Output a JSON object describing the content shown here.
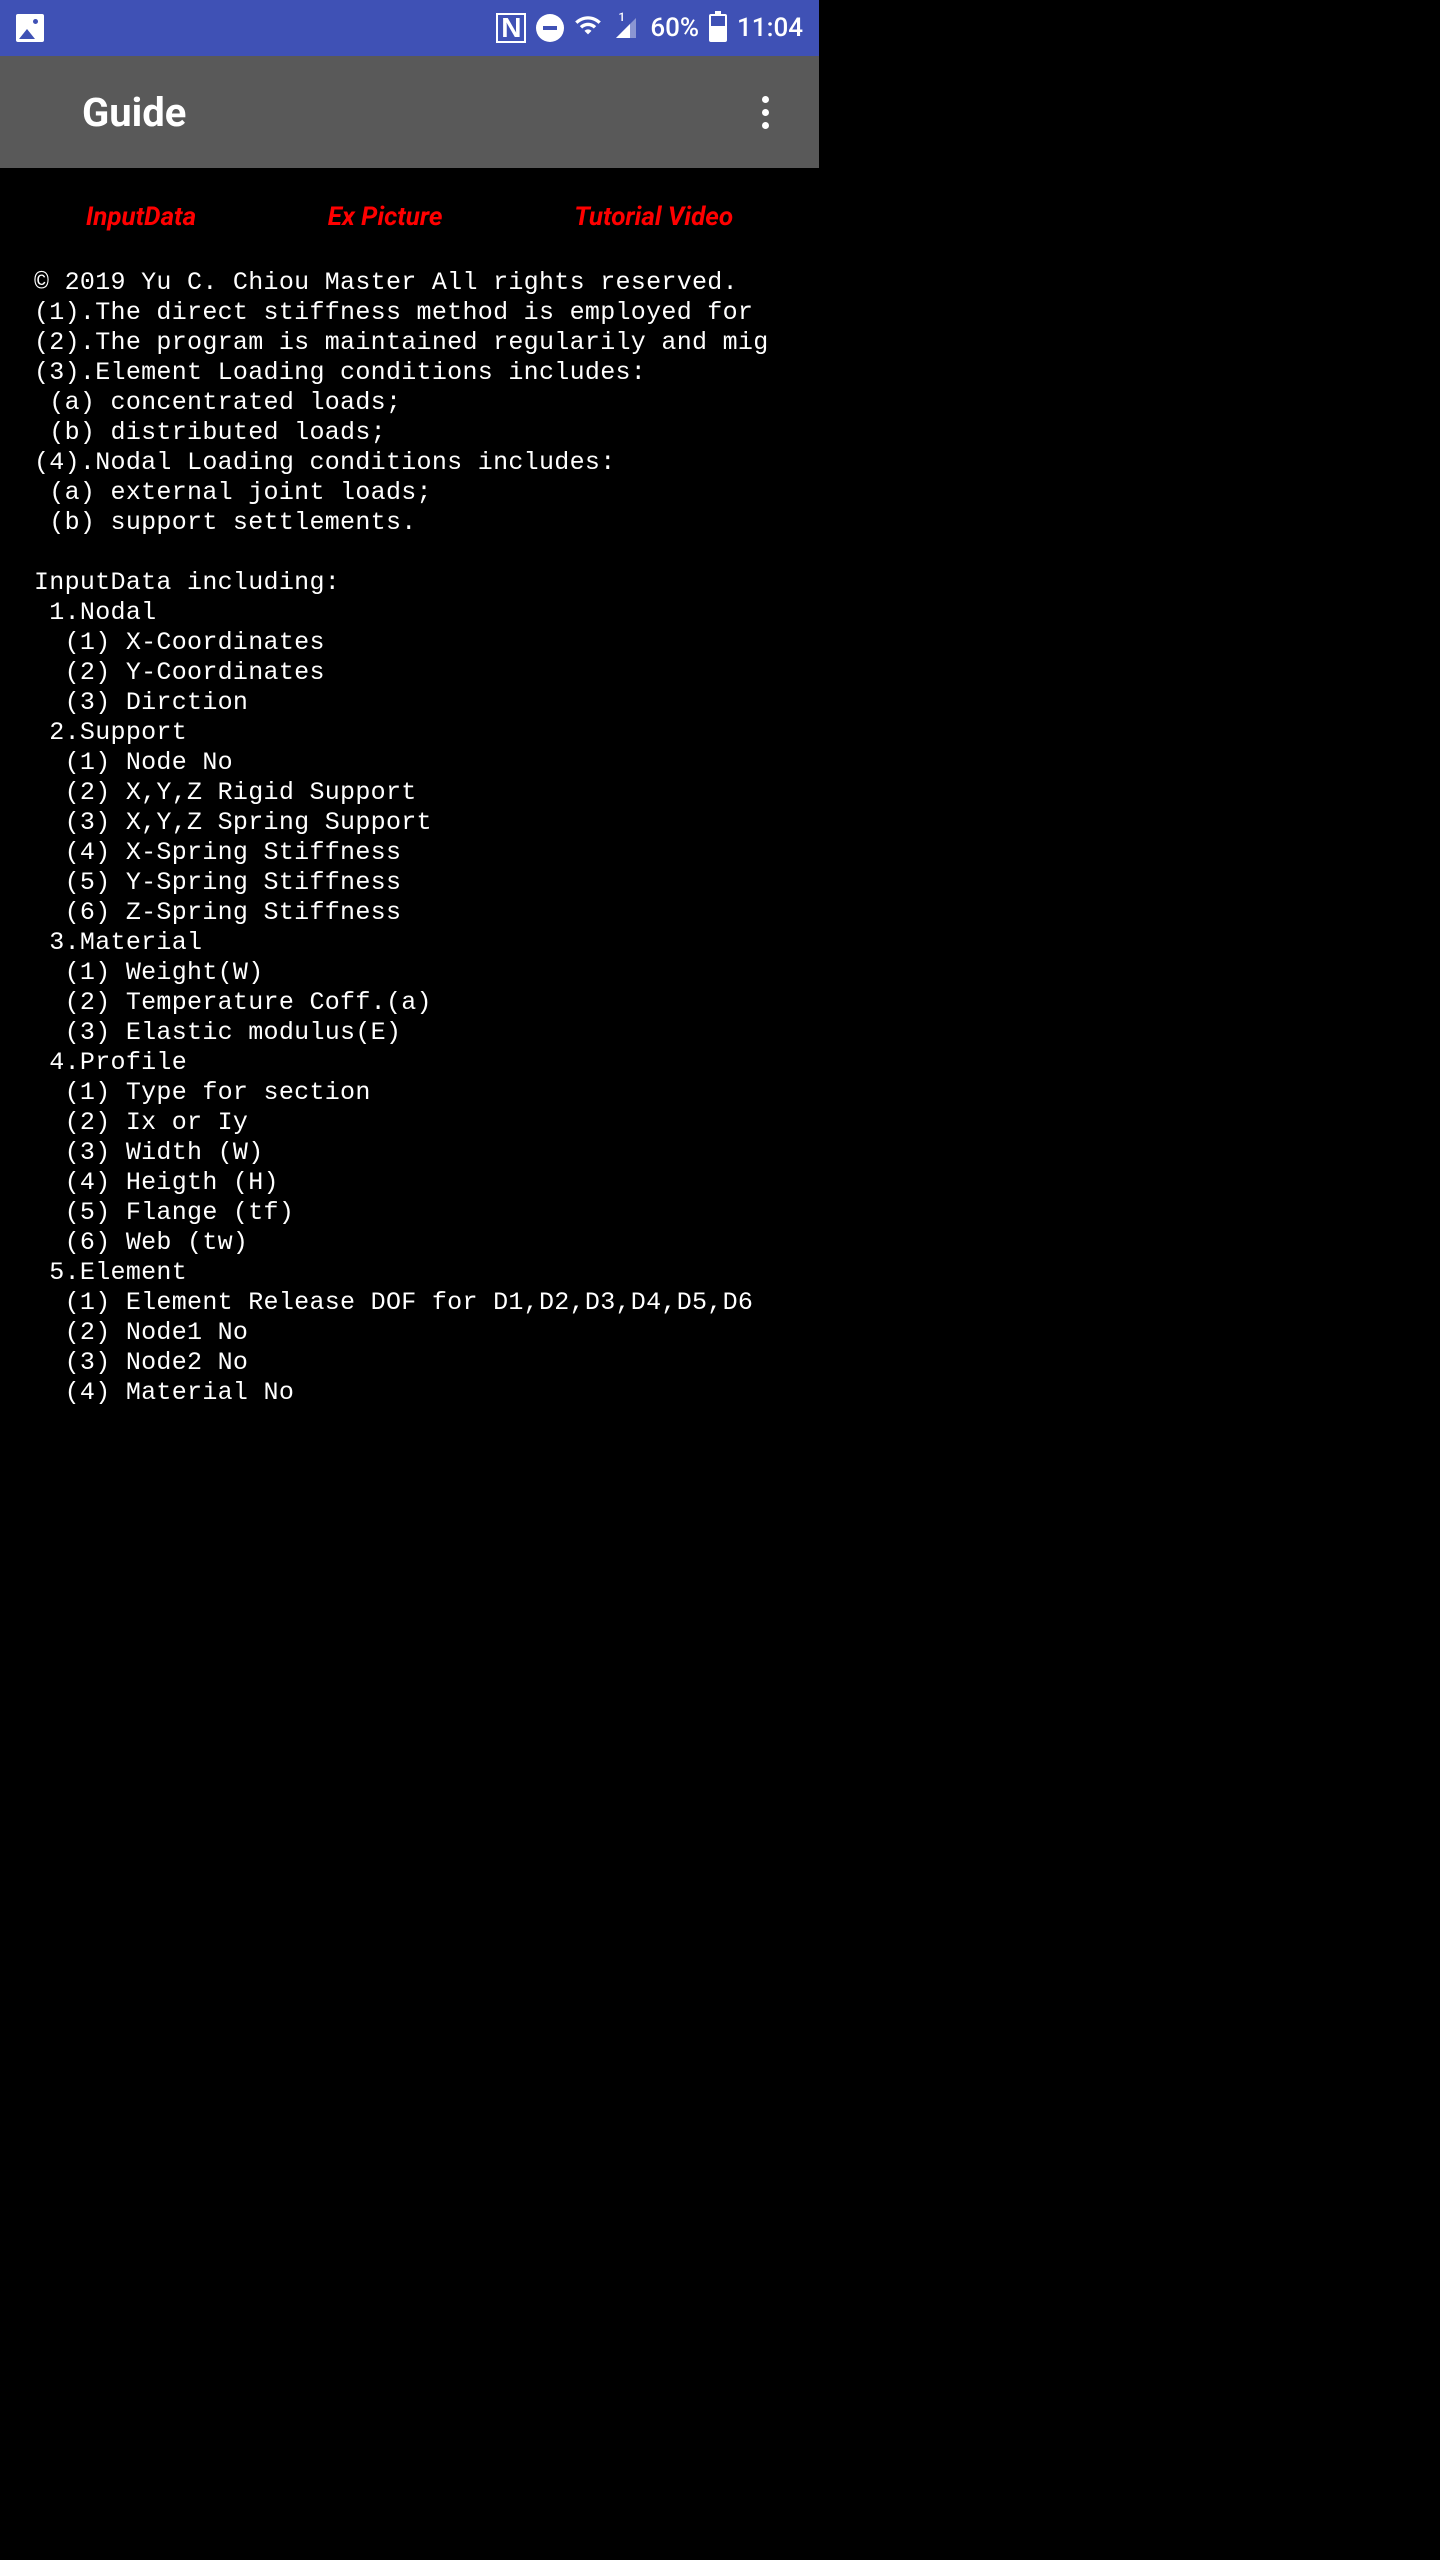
{
  "status": {
    "battery_pct": "60%",
    "time": "11:04",
    "signal_sup": "1"
  },
  "appbar": {
    "title": "Guide"
  },
  "tabs": {
    "t1": "InputData",
    "t2": "Ex Picture",
    "t3": "Tutorial Video"
  },
  "content_text": "© 2019 Yu C. Chiou Master All rights reserved.\n(1).The direct stiffness method is employed for\n(2).The program is maintained regularily and mig\n(3).Element Loading conditions includes:\n (a) concentrated loads;\n (b) distributed loads;\n(4).Nodal Loading conditions includes:\n (a) external joint loads;\n (b) support settlements.\n\nInputData including:\n 1.Nodal\n  (1) X-Coordinates\n  (2) Y-Coordinates\n  (3) Dirction\n 2.Support\n  (1) Node No\n  (2) X,Y,Z Rigid Support\n  (3) X,Y,Z Spring Support\n  (4) X-Spring Stiffness\n  (5) Y-Spring Stiffness\n  (6) Z-Spring Stiffness\n 3.Material\n  (1) Weight(W)\n  (2) Temperature Coff.(a)\n  (3) Elastic modulus(E)\n 4.Profile\n  (1) Type for section\n  (2) Ix or Iy\n  (3) Width (W)\n  (4) Heigth (H)\n  (5) Flange (tf)\n  (6) Web (tw)\n 5.Element\n  (1) Element Release DOF for D1,D2,D3,D4,D5,D6\n  (2) Node1 No\n  (3) Node2 No\n  (4) Material No"
}
